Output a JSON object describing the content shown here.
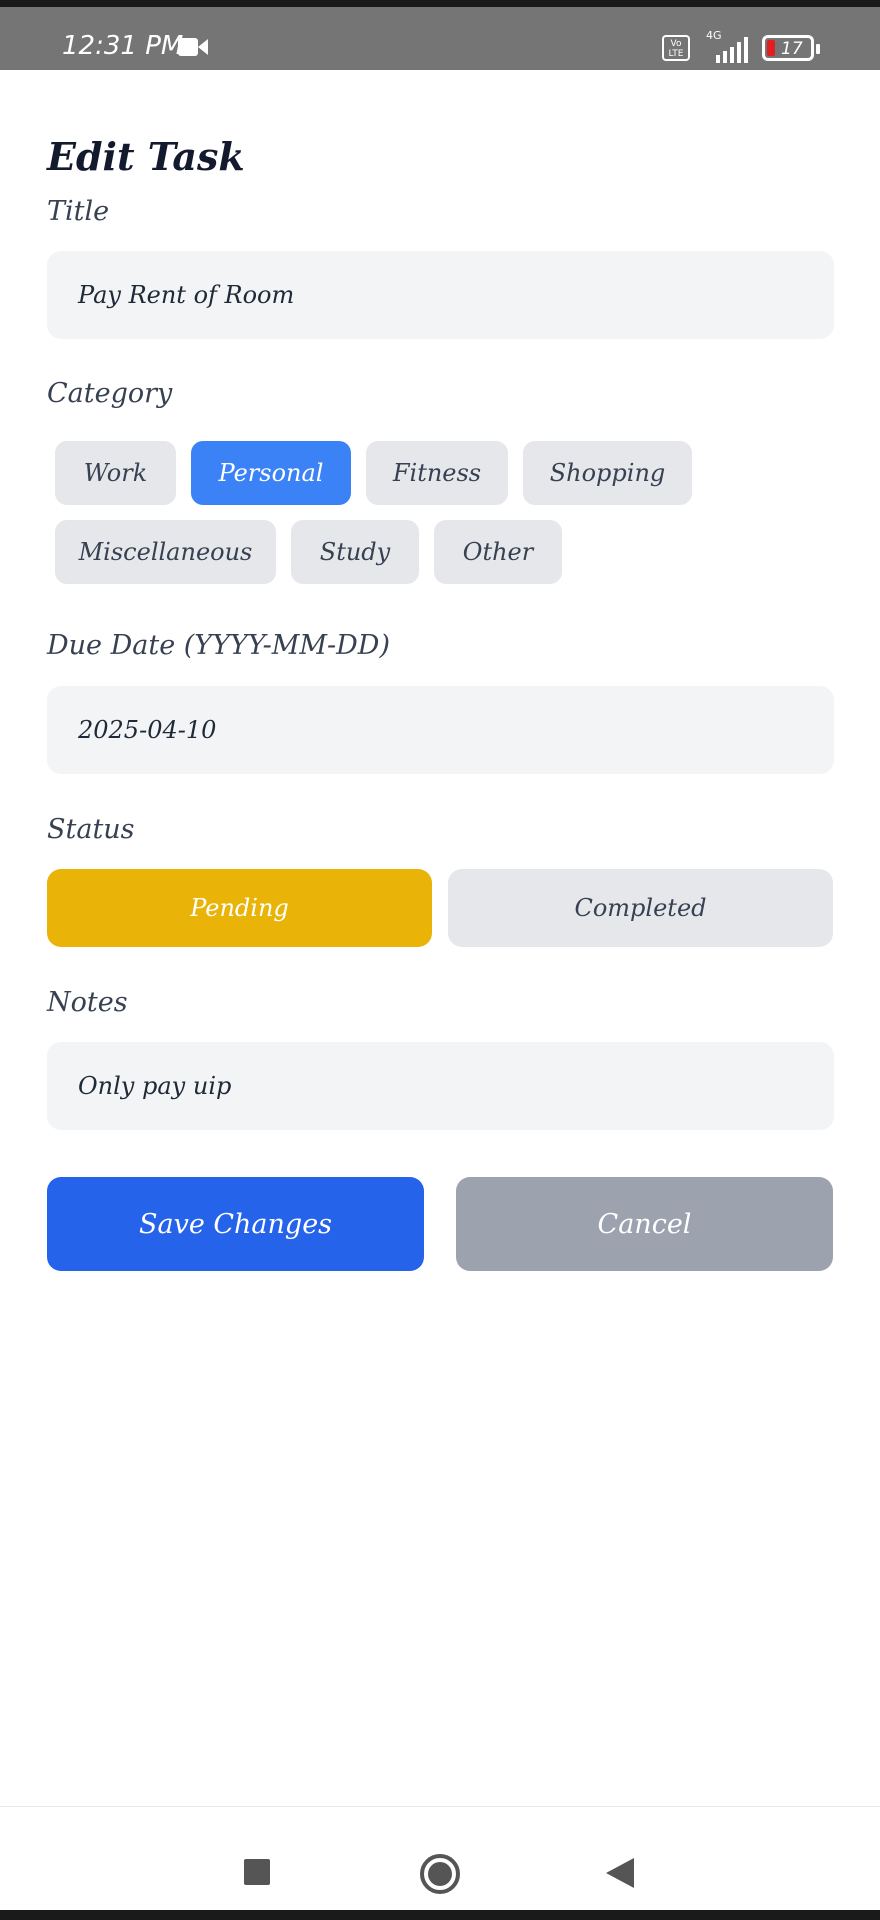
{
  "status_bar": {
    "time": "12:31 PM",
    "camera_icon": "video-camera-icon",
    "volte": "Vo LTE",
    "network": "4G",
    "battery": "17"
  },
  "form": {
    "title": "Edit Task",
    "title_label": "Title",
    "title_value": "Pay Rent of Room",
    "category_label": "Category",
    "categories": [
      "Work",
      "Personal",
      "Fitness",
      "Shopping",
      "Miscellaneous",
      "Study",
      "Other"
    ],
    "selected_category": "Personal",
    "due_date_label": "Due Date (YYYY-MM-DD)",
    "due_date_value": "2025-04-10",
    "status_label": "Status",
    "status_options": [
      "Pending",
      "Completed"
    ],
    "selected_status": "Pending",
    "notes_label": "Notes",
    "notes_value": "Only pay uip",
    "save_label": "Save Changes",
    "cancel_label": "Cancel"
  },
  "colors": {
    "selected_category": "#3b82f6",
    "pending": "#eab308",
    "save": "#2563eb",
    "cancel": "#9ca3af"
  },
  "nav_bar": {
    "icons": [
      "recents-square-icon",
      "home-circle-icon",
      "back-triangle-icon"
    ]
  }
}
